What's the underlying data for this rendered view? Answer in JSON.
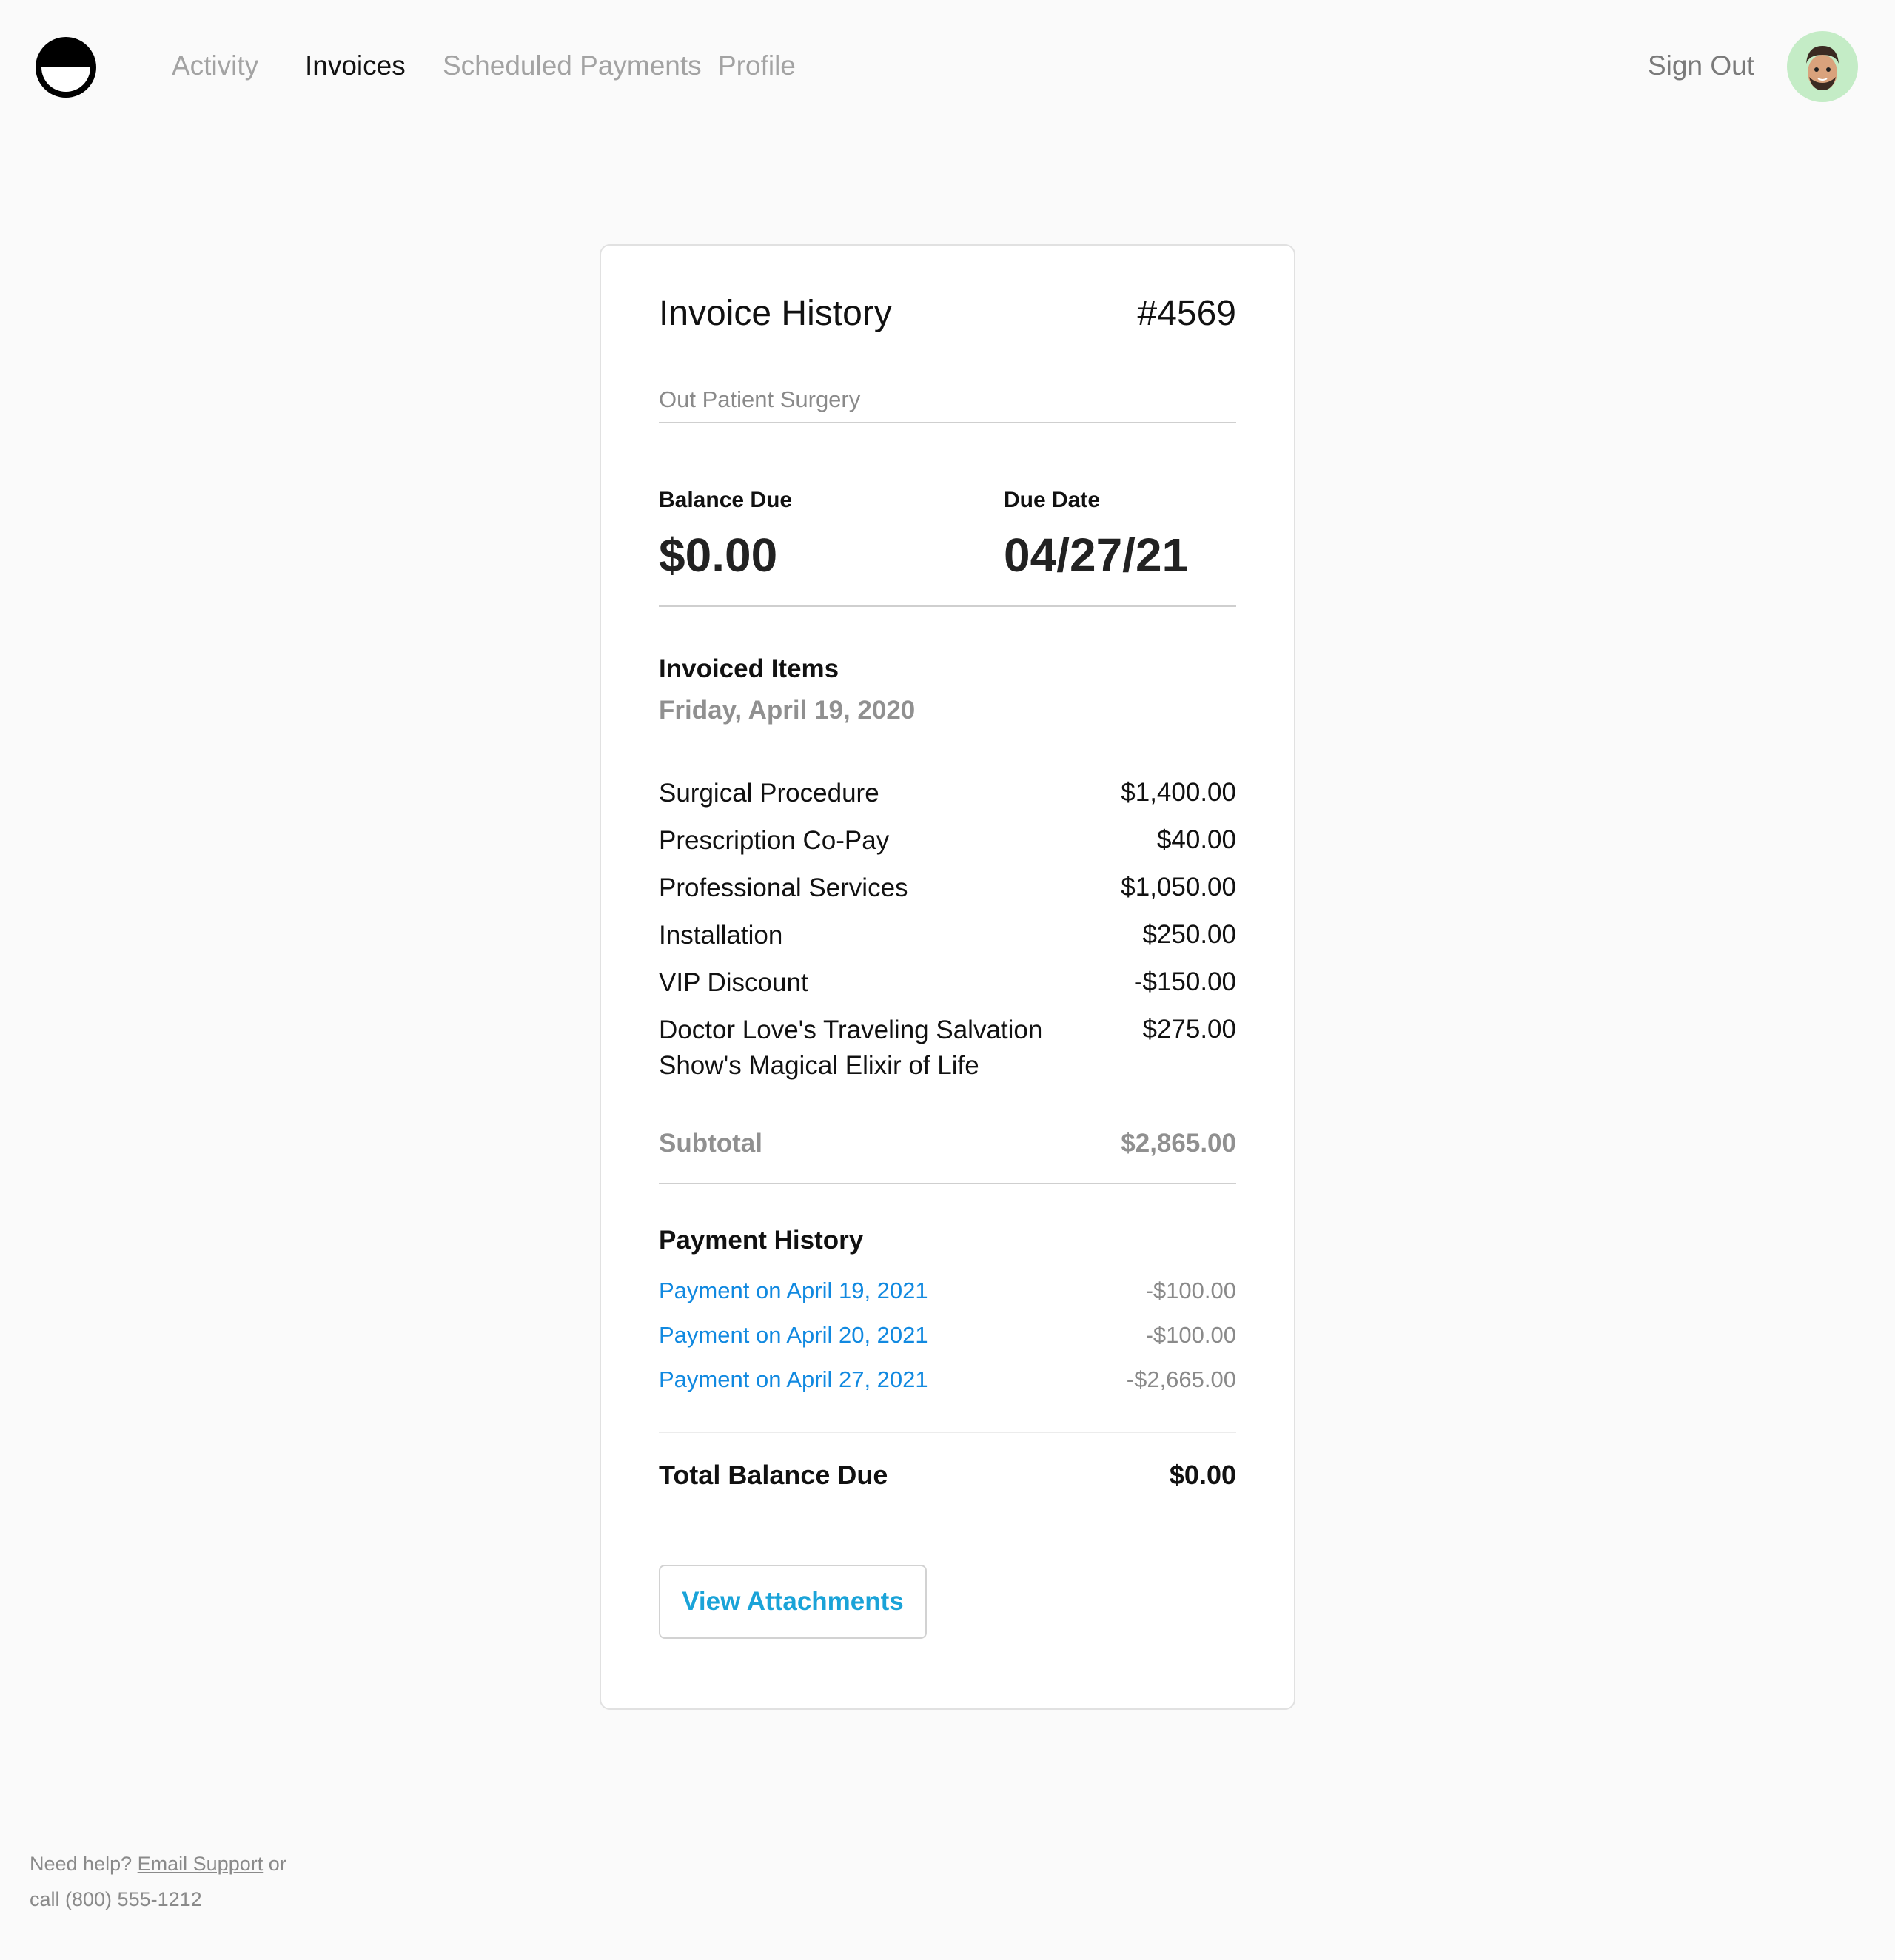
{
  "nav": {
    "items": [
      {
        "label": "Activity",
        "active": false
      },
      {
        "label": "Invoices",
        "active": true
      },
      {
        "label": "Scheduled Payments",
        "active": false
      },
      {
        "label": "Profile",
        "active": false
      }
    ],
    "sign_out": "Sign Out"
  },
  "invoice": {
    "title": "Invoice History",
    "number": "#4569",
    "subtitle": "Out Patient Surgery",
    "balance_due_label": "Balance Due",
    "balance_due": "$0.00",
    "due_date_label": "Due Date",
    "due_date": "04/27/21",
    "items_heading": "Invoiced Items",
    "items_date": "Friday, April 19, 2020",
    "items": [
      {
        "name": "Surgical Procedure",
        "amount": "$1,400.00"
      },
      {
        "name": "Prescription Co-Pay",
        "amount": "$40.00"
      },
      {
        "name": "Professional Services",
        "amount": "$1,050.00"
      },
      {
        "name": "Installation",
        "amount": "$250.00"
      },
      {
        "name": "VIP Discount",
        "amount": "-$150.00"
      },
      {
        "name": "Doctor Love's Traveling Salvation Show's Magical Elixir of Life",
        "amount": "$275.00"
      }
    ],
    "subtotal_label": "Subtotal",
    "subtotal": "$2,865.00",
    "payment_history_heading": "Payment History",
    "payments": [
      {
        "label": "Payment on April 19, 2021",
        "amount": "-$100.00"
      },
      {
        "label": "Payment on April 20, 2021",
        "amount": "-$100.00"
      },
      {
        "label": "Payment on April 27, 2021",
        "amount": "-$2,665.00"
      }
    ],
    "total_label": "Total Balance Due",
    "total": "$0.00",
    "view_attachments": "View Attachments"
  },
  "footer": {
    "help_prefix": "Need help?",
    "email_link": "Email Support",
    "help_suffix": "or",
    "call_text": "call (800) 555-1212"
  },
  "colors": {
    "link": "#1189e0",
    "button_text": "#1aa3d8",
    "avatar_bg": "#c4ecc6"
  }
}
